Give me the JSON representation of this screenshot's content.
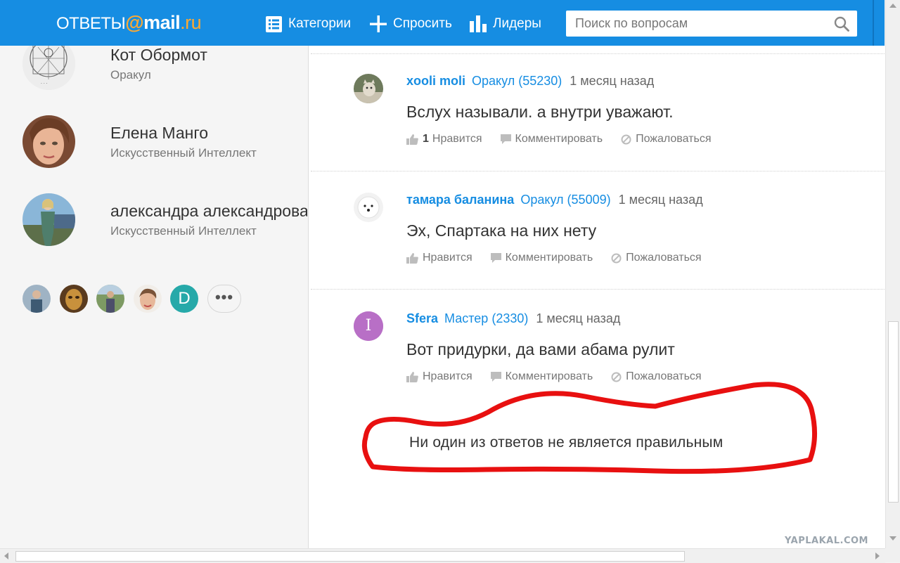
{
  "header": {
    "logo": {
      "otvety": "ОТВЕТЫ",
      "at": "@",
      "mail": "mail",
      "ru": ".ru"
    },
    "nav": {
      "categories": "Категории",
      "ask": "Спросить",
      "leaders": "Лидеры"
    },
    "search": {
      "placeholder": "Поиск по вопросам",
      "value": ""
    },
    "colors": {
      "bar": "#168de2",
      "logo_accent": "#ffa930"
    }
  },
  "sidebar": {
    "leaders": [
      {
        "name": "Кот Обормот",
        "rank": "Оракул",
        "avatar": "sketch-drawing"
      },
      {
        "name": "Елена Манго",
        "rank": "Искусственный Интеллект",
        "avatar": "woman-portrait"
      },
      {
        "name": "александра александрова",
        "rank": "Искусственный Интеллект",
        "avatar": "woman-outdoor-photo"
      }
    ],
    "mini_avatars": [
      {
        "avatar": "person-photo"
      },
      {
        "avatar": "mask-photo"
      },
      {
        "avatar": "person-outdoor-photo"
      },
      {
        "avatar": "woman-face-photo"
      },
      {
        "letter": "D"
      }
    ],
    "more_label": "•••"
  },
  "answers": [
    {
      "user": "xooli moli",
      "level": "Оракул (55230)",
      "time": "1 месяц назад",
      "text": "Вслух называли. а внутри уважают.",
      "likes": "1",
      "like_label": "Нравится",
      "comment_label": "Комментировать",
      "report_label": "Пожаловаться",
      "avatar": "cat-photo"
    },
    {
      "user": "тамара баланина",
      "level": "Оракул (55009)",
      "time": "1 месяц назад",
      "text": "Эх, Спартака на них нету",
      "likes": "",
      "like_label": "Нравится",
      "comment_label": "Комментировать",
      "report_label": "Пожаловаться",
      "avatar": "white-dog-photo"
    },
    {
      "user": "Sfera",
      "level": "Мастер (2330)",
      "time": "1 месяц назад",
      "text": "Вот придурки, да вами абама рулит",
      "likes": "",
      "like_label": "Нравится",
      "comment_label": "Комментировать",
      "report_label": "Пожаловаться",
      "avatar_letter": "I",
      "avatar_color": "#b86fc6"
    }
  ],
  "no_best_answer": "Ни один из ответов не является правильным",
  "watermark": "YAPLAKAL.COM"
}
